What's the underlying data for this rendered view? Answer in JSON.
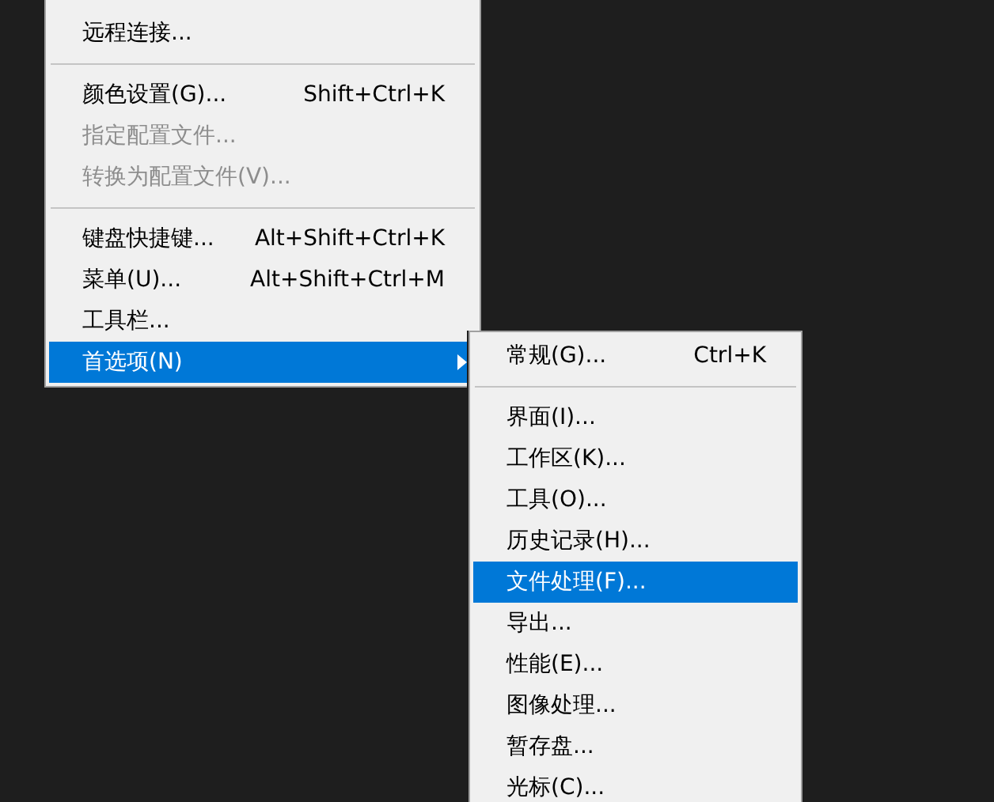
{
  "menu": {
    "items": [
      {
        "kind": "item",
        "label": "远程连接...",
        "disabled": false,
        "selected": false,
        "submenu": false
      },
      {
        "kind": "separator"
      },
      {
        "kind": "item",
        "label": "颜色设置(G)...",
        "shortcut": "Shift+Ctrl+K",
        "disabled": false,
        "selected": false,
        "submenu": false
      },
      {
        "kind": "item",
        "label": "指定配置文件...",
        "disabled": true,
        "selected": false,
        "submenu": false
      },
      {
        "kind": "item",
        "label": "转换为配置文件(V)...",
        "disabled": true,
        "selected": false,
        "submenu": false
      },
      {
        "kind": "separator"
      },
      {
        "kind": "item",
        "label": "键盘快捷键...",
        "shortcut": "Alt+Shift+Ctrl+K",
        "disabled": false,
        "selected": false,
        "submenu": false
      },
      {
        "kind": "item",
        "label": "菜单(U)...",
        "shortcut": "Alt+Shift+Ctrl+M",
        "disabled": false,
        "selected": false,
        "submenu": false
      },
      {
        "kind": "item",
        "label": "工具栏...",
        "disabled": false,
        "selected": false,
        "submenu": false
      },
      {
        "kind": "item",
        "label": "首选项(N)",
        "disabled": false,
        "selected": true,
        "submenu": true
      }
    ]
  },
  "submenu": {
    "items": [
      {
        "kind": "item",
        "label": "常规(G)...",
        "shortcut": "Ctrl+K",
        "disabled": false,
        "selected": false,
        "submenu": false
      },
      {
        "kind": "separator"
      },
      {
        "kind": "item",
        "label": "界面(I)...",
        "disabled": false,
        "selected": false,
        "submenu": false
      },
      {
        "kind": "item",
        "label": "工作区(K)...",
        "disabled": false,
        "selected": false,
        "submenu": false
      },
      {
        "kind": "item",
        "label": "工具(O)...",
        "disabled": false,
        "selected": false,
        "submenu": false
      },
      {
        "kind": "item",
        "label": "历史记录(H)...",
        "disabled": false,
        "selected": false,
        "submenu": false
      },
      {
        "kind": "item",
        "label": "文件处理(F)...",
        "disabled": false,
        "selected": true,
        "submenu": false
      },
      {
        "kind": "item",
        "label": "导出...",
        "disabled": false,
        "selected": false,
        "submenu": false
      },
      {
        "kind": "item",
        "label": "性能(E)...",
        "disabled": false,
        "selected": false,
        "submenu": false
      },
      {
        "kind": "item",
        "label": "图像处理...",
        "disabled": false,
        "selected": false,
        "submenu": false
      },
      {
        "kind": "item",
        "label": "暂存盘...",
        "disabled": false,
        "selected": false,
        "submenu": false
      },
      {
        "kind": "item",
        "label": "光标(C)...",
        "disabled": false,
        "selected": false,
        "submenu": false
      }
    ]
  }
}
